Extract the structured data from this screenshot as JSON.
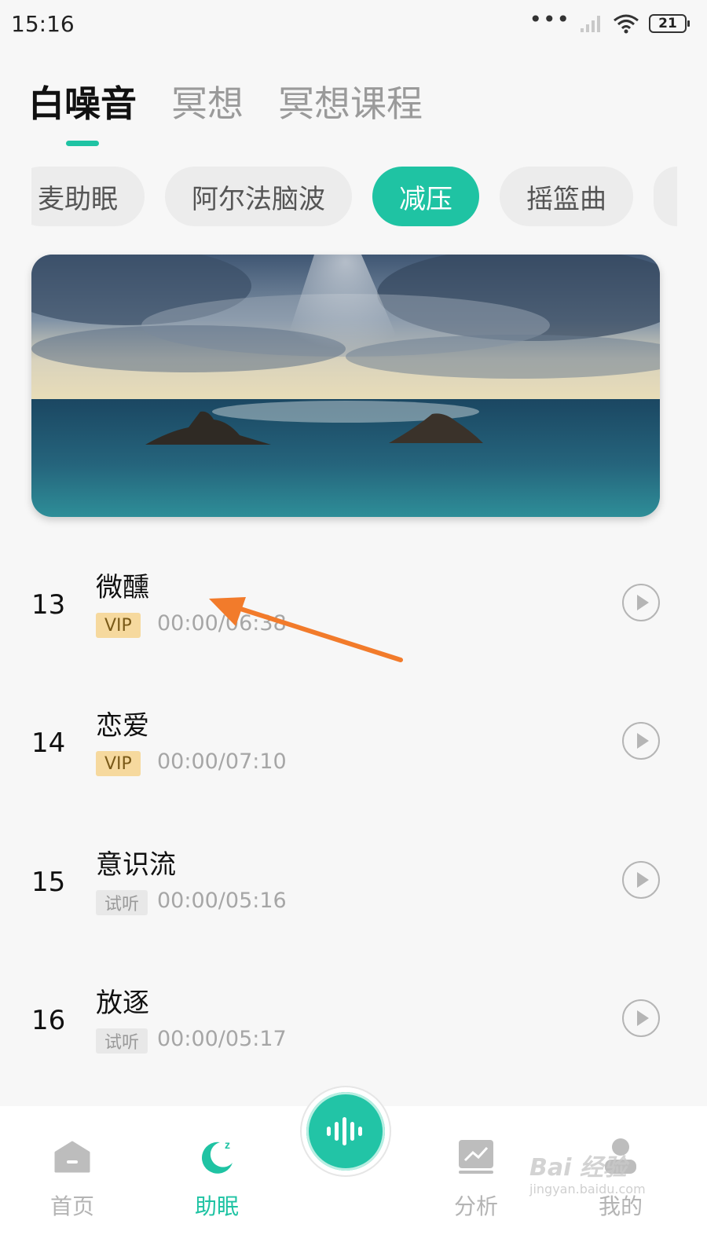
{
  "status_bar": {
    "time": "15:16",
    "battery": "21"
  },
  "main_tabs": [
    {
      "label": "白噪音",
      "active": true
    },
    {
      "label": "冥想",
      "active": false
    },
    {
      "label": "冥想课程",
      "active": false
    }
  ],
  "categories": [
    {
      "label": "麦助眠",
      "active": false
    },
    {
      "label": "阿尔法脑波",
      "active": false
    },
    {
      "label": "减压",
      "active": true
    },
    {
      "label": "摇篮曲",
      "active": false
    }
  ],
  "tracks": [
    {
      "num": "13",
      "title": "微醺",
      "badge": "VIP",
      "badge_type": "vip",
      "time": "00:00/06:38"
    },
    {
      "num": "14",
      "title": "恋爱",
      "badge": "VIP",
      "badge_type": "vip",
      "time": "00:00/07:10"
    },
    {
      "num": "15",
      "title": "意识流",
      "badge": "试听",
      "badge_type": "trial",
      "time": "00:00/05:16"
    },
    {
      "num": "16",
      "title": "放逐",
      "badge": "试听",
      "badge_type": "trial",
      "time": "00:00/05:17"
    }
  ],
  "bottom_nav": [
    {
      "label": "首页",
      "icon": "home-icon",
      "active": false
    },
    {
      "label": "助眠",
      "icon": "sleep-moon-icon",
      "active": true
    },
    {
      "label": "分析",
      "icon": "analysis-chart-icon",
      "active": false
    },
    {
      "label": "我的",
      "icon": "profile-icon",
      "active": false
    }
  ],
  "center_button": {
    "icon": "sound-wave-icon"
  },
  "watermark": {
    "brand": "Bai 经验",
    "sub": "jingyan.baidu.com"
  },
  "colors": {
    "accent": "#1fc3a3",
    "vip_badge": "#f6d99e",
    "annotation_arrow": "#f27b2b"
  }
}
